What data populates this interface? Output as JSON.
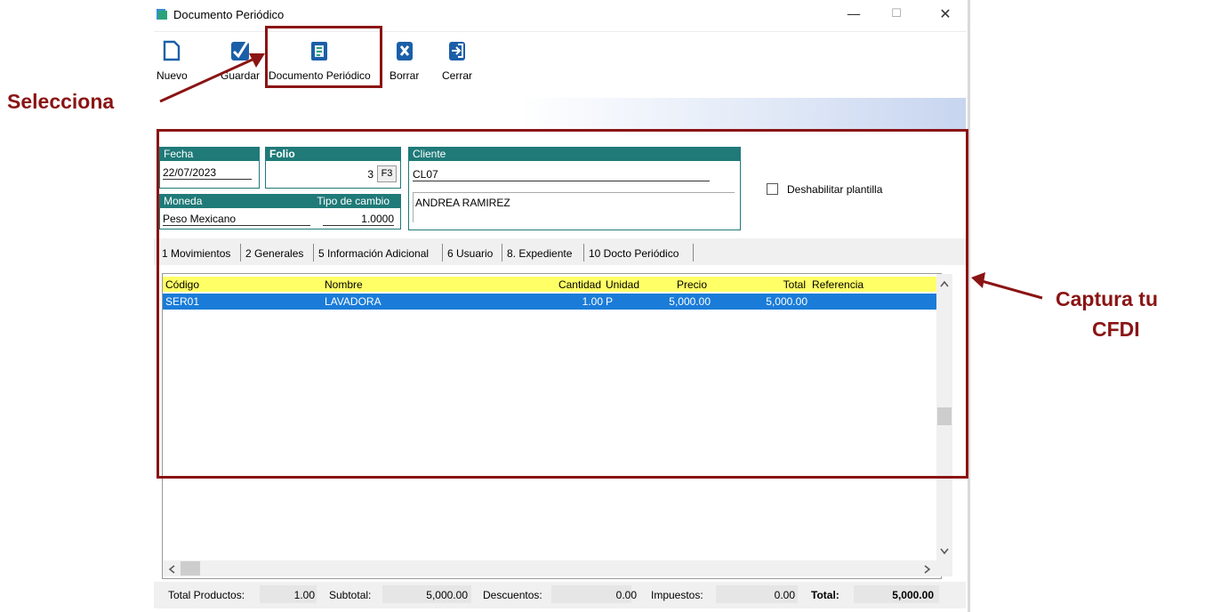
{
  "window": {
    "title": "Documento Periódico",
    "controls": [
      "—",
      "☐",
      "✕"
    ]
  },
  "toolbar": {
    "buttons": [
      {
        "label": "Nuevo",
        "icon": "new-document-icon"
      },
      {
        "label": "Guardar",
        "icon": "checkmark-icon"
      },
      {
        "label": "Documento Periódico",
        "icon": "periodic-document-icon"
      },
      {
        "label": "Borrar",
        "icon": "delete-x-icon"
      },
      {
        "label": "Cerrar",
        "icon": "exit-door-icon"
      }
    ]
  },
  "form": {
    "fecha_label": "Fecha",
    "fecha_value": "22/07/2023",
    "folio_label": "Folio",
    "folio_value": "3",
    "folio_button": "F3",
    "cliente_label": "Cliente",
    "cliente_code": "CL07",
    "cliente_name": "ANDREA RAMIREZ",
    "moneda_label": "Moneda",
    "moneda_value": "Peso Mexicano",
    "tipo_cambio_label": "Tipo de cambio",
    "tipo_cambio_value": "1.0000",
    "deshabilitar_label": "Deshabilitar plantilla",
    "deshabilitar_checked": false
  },
  "tabs": [
    "1 Movimientos",
    "2 Generales",
    "5 Información Adicional",
    "6 Usuario",
    "8. Expediente",
    "10 Docto Periódico"
  ],
  "grid": {
    "columns": [
      "Código",
      "Nombre",
      "Cantidad",
      "Unidad",
      "Precio",
      "Total",
      "Referencia"
    ],
    "rows": [
      {
        "codigo": "SER01",
        "nombre": "LAVADORA",
        "cantidad": "1.00",
        "unidad": "P",
        "precio": "5,000.00",
        "total": "5,000.00",
        "referencia": ""
      }
    ]
  },
  "footer": {
    "total_productos_label": "Total Productos:",
    "total_productos_value": "1.00",
    "subtotal_label": "Subtotal:",
    "subtotal_value": "5,000.00",
    "descuentos_label": "Descuentos:",
    "descuentos_value": "0.00",
    "impuestos_label": "Impuestos:",
    "impuestos_value": "0.00",
    "total_label": "Total:",
    "total_value": "5,000.00"
  },
  "annotations": {
    "selecciona": "Selecciona",
    "captura_line1": "Captura tu",
    "captura_line2": "CFDI"
  },
  "colors": {
    "accent": "#1f7a78",
    "selection": "#1a7cd8",
    "header_yellow": "#ffff66",
    "annotation": "#8b1414"
  }
}
